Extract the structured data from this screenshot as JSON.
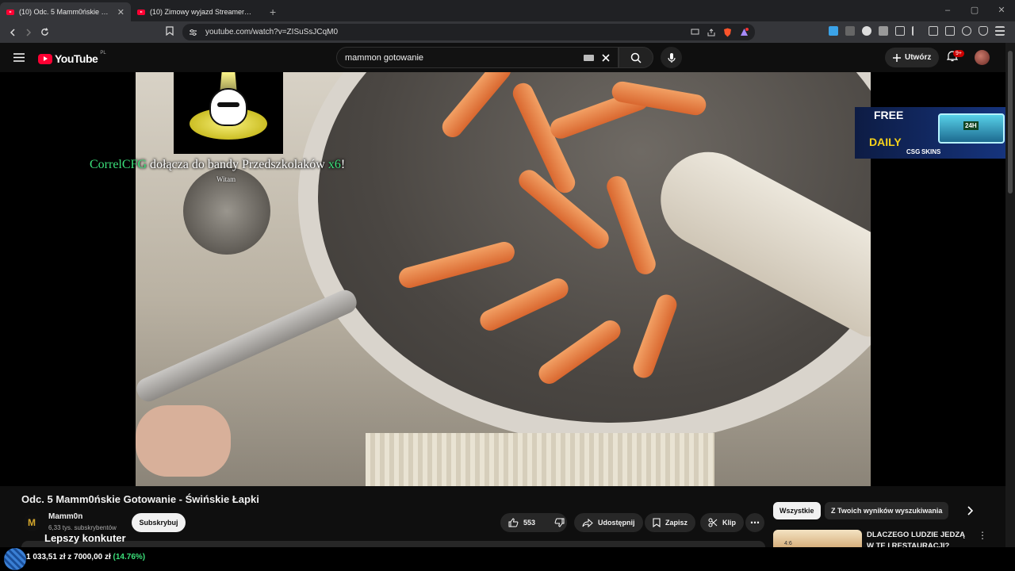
{
  "browser": {
    "tabs": [
      {
        "title": "(10) Odc. 5 Mamm0ńskie Gotow",
        "active": true
      },
      {
        "title": "(10) Zimowy wyjazd Streamerów - Fi",
        "active": false
      }
    ],
    "url": "youtube.com/watch?v=ZISuSsJCqM0",
    "ext_badge": "1"
  },
  "header": {
    "logo": "YouTube",
    "country": "PL",
    "search_value": "mammon gotowanie",
    "create_label": "Utwórz",
    "notif_count": "9+"
  },
  "video_overlay": {
    "alert_name": "CorrelCFG",
    "alert_text": " dołącza do bandy Przedszkolaków ",
    "alert_mult": "x6",
    "alert_end": "!",
    "alert_sub": "Witam",
    "ad_free": "FREE",
    "ad_daily": "DAILY",
    "ad_brand": "CSG SKINS",
    "ad_case": "24H"
  },
  "video": {
    "title": "Odc. 5 Mamm0ńskie Gotowanie - Świńskie Łapki",
    "channel": "Mamm0n",
    "channel_initial": "M",
    "subscribers": "6,33 tys. subskrybentów",
    "subscribe_label": "Subskrybuj",
    "likes": "553",
    "share_label": "Udostępnij",
    "save_label": "Zapisz",
    "clip_label": "Klip"
  },
  "overlay_title": "Lepszy konkuter",
  "sidebar": {
    "chips": [
      "Wszystkie",
      "Z Twoich wyników wyszukiwania"
    ],
    "rec_title": "DLACZEGO LUDZIE JEDZĄ W TE I RESTAURACJI?",
    "rec_thumb_text": "4:6"
  },
  "goal": {
    "text": "1 033,51 zł z 7000,00 zł",
    "percent": "(14.76%)"
  }
}
